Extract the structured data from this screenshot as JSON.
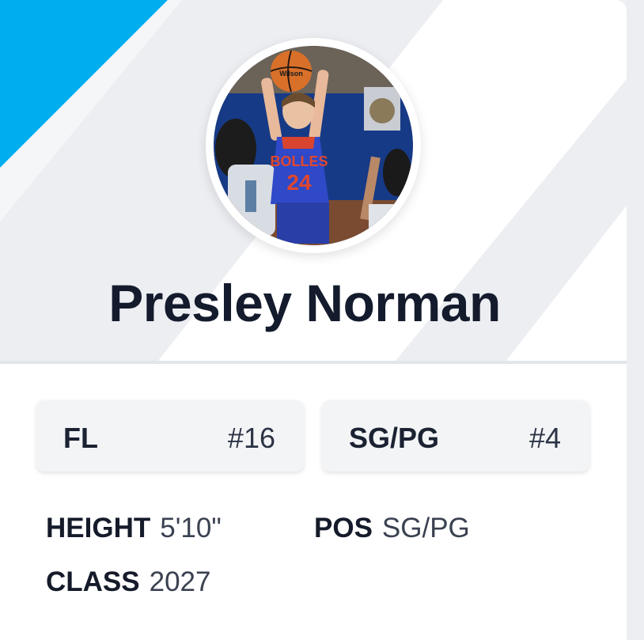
{
  "player": {
    "name": "Presley Norman",
    "jersey_on_photo": "24",
    "jersey_text_on_photo": "BOLLES",
    "ball_brand_on_photo": "Wilson"
  },
  "teams": [
    {
      "label": "FL",
      "number": "#16"
    },
    {
      "label": "SG/PG",
      "number": "#4"
    }
  ],
  "attributes": {
    "height_label": "HEIGHT",
    "height_value": "5'10\"",
    "pos_label": "POS",
    "pos_value": "SG/PG",
    "class_label": "CLASS",
    "class_value": "2027"
  },
  "colors": {
    "accent": "#00aef0",
    "name": "#141b2d",
    "chip_bg": "#f3f4f6"
  }
}
